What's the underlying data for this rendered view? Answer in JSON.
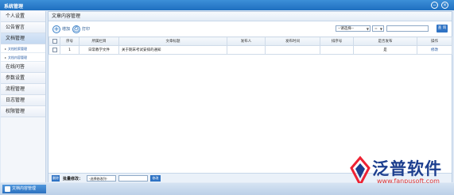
{
  "window": {
    "title": "系统管理",
    "min_glyph": "−",
    "close_glyph": "×"
  },
  "sidebar": {
    "items": [
      {
        "label": "个人设置",
        "active": false
      },
      {
        "label": "公告留言",
        "active": false
      },
      {
        "label": "文档管理",
        "active": true
      },
      {
        "label": "在线问答",
        "active": false
      },
      {
        "label": "参数设置",
        "active": false
      },
      {
        "label": "流程管理",
        "active": false
      },
      {
        "label": "日志管理",
        "active": false
      },
      {
        "label": "权限管理",
        "active": false
      }
    ],
    "subitems": [
      {
        "label": "文档检索管理"
      },
      {
        "label": "文档内容管理"
      }
    ]
  },
  "panel": {
    "title": "文章内容管理"
  },
  "toolbar": {
    "add_label": "增加",
    "print_label": "打印",
    "add_icon": "plus-icon",
    "print_icon": "printer-icon",
    "filter_select": "--请选择--",
    "op_select": "=",
    "search_value": "",
    "query_label": "查 询"
  },
  "table": {
    "headers": [
      "",
      "序号",
      "所属栏目",
      "文章标题",
      "发布人",
      "发布时间",
      "排序号",
      "是否发布",
      "操作"
    ],
    "rows": [
      {
        "index": "1",
        "column": "日常教学文件",
        "title": "关于期末考试安排的通知",
        "publisher": "",
        "time": "",
        "order": "",
        "published": "是",
        "action": "修改"
      }
    ]
  },
  "footer": {
    "delete_label": "删除",
    "batch_label": "批量修改：",
    "batch_select": "-选择修改列-",
    "batch_value": "",
    "ok_label": "修改"
  },
  "taskbar": {
    "tab_label": "文档内容管理"
  },
  "watermark": {
    "brand": "泛普软件",
    "url": "www.fanpusoft.com"
  },
  "colors": {
    "accent": "#2f73c4",
    "title_bar": "#1f6fbf",
    "brand": "#1c3e8e",
    "url": "#dd3333"
  }
}
